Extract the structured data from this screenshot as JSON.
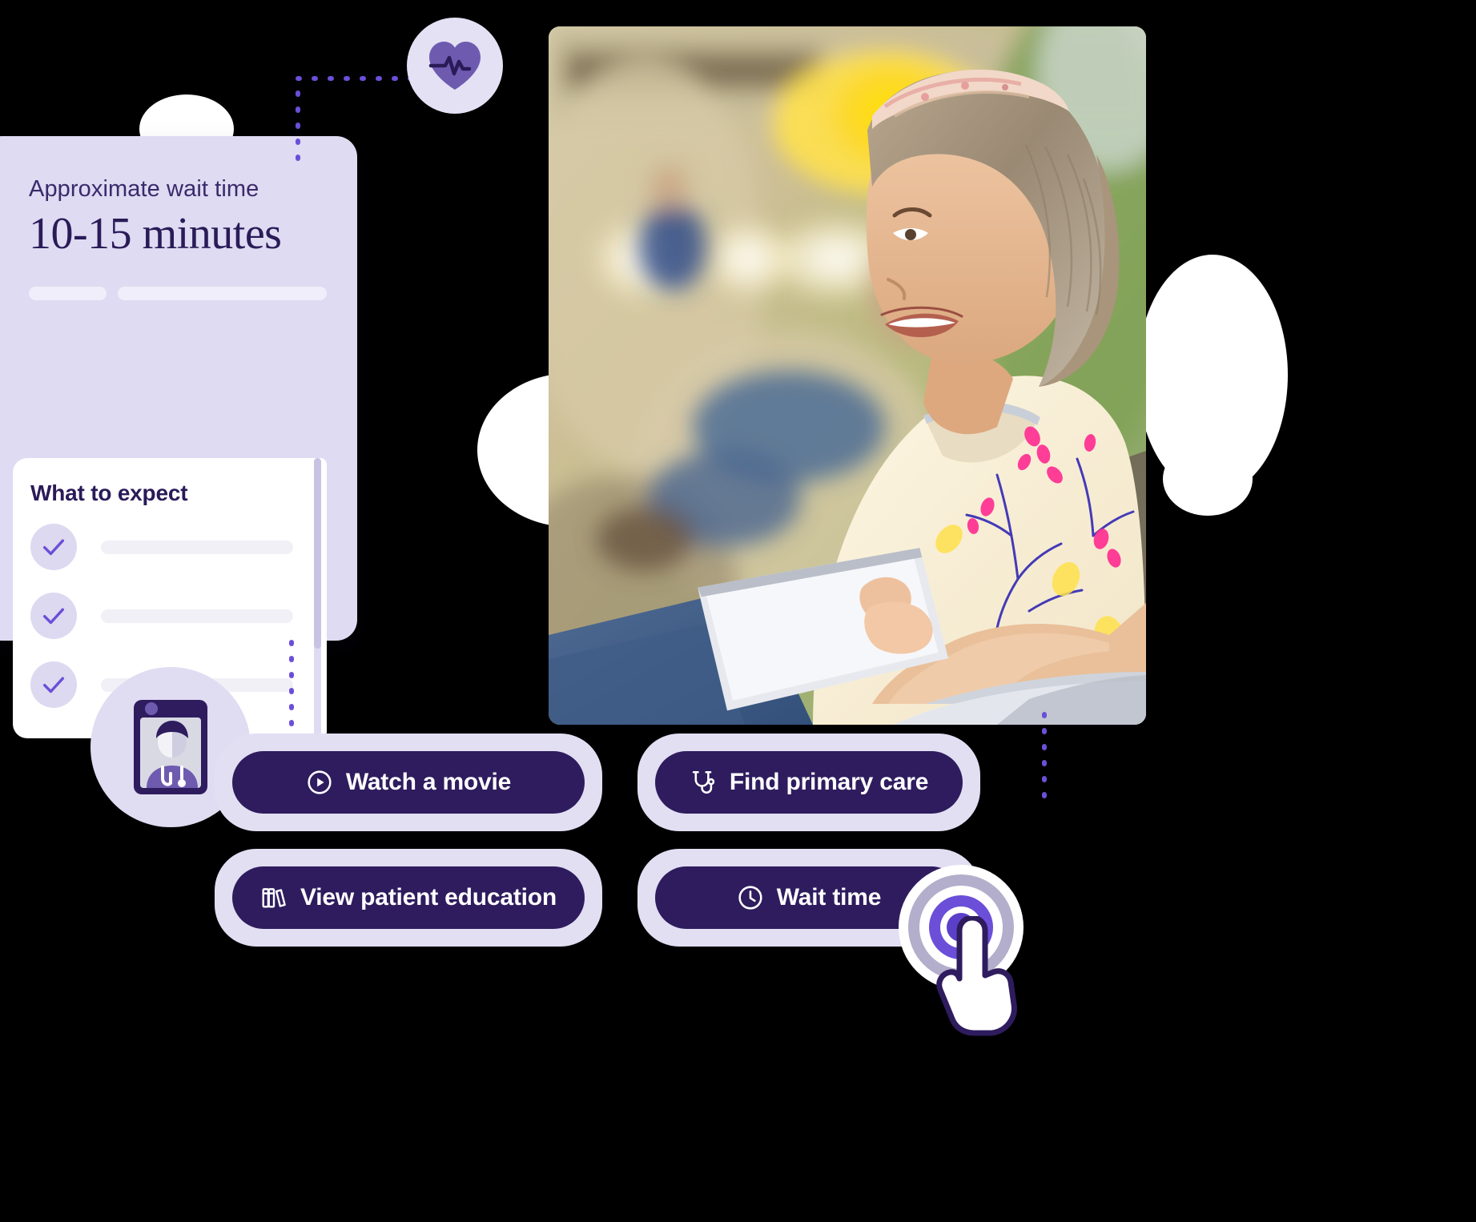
{
  "card": {
    "wait_label": "Approximate wait time",
    "wait_value": "10-15 minutes",
    "expect_title": "What to expect",
    "checklist": [
      {
        "icon": "check-icon",
        "text": ""
      },
      {
        "icon": "check-icon",
        "text": ""
      },
      {
        "icon": "check-icon",
        "text": ""
      }
    ]
  },
  "badges": {
    "heart": "heart-pulse-icon",
    "telehealth": "telehealth-video-icon"
  },
  "photo": {
    "alt": "Smiling woman with headband sitting in a waiting room using a tablet"
  },
  "actions": {
    "buttons": [
      {
        "label": "Watch a movie",
        "icon": "play-circle-icon"
      },
      {
        "label": "Find primary care",
        "icon": "stethoscope-icon"
      },
      {
        "label": "View patient education",
        "icon": "books-icon"
      },
      {
        "label": "Wait time",
        "icon": "clock-icon"
      }
    ]
  },
  "cursor": {
    "icon": "pointing-hand-cursor",
    "target": "Wait time"
  },
  "colors": {
    "card_bg": "#dedbf2",
    "button_bg": "#2e1c5e",
    "button_wrap_bg": "#e2dff3",
    "accent_purple": "#6b4fd8",
    "text_dark": "#2a1b58",
    "badge_bg": "#e0dcf2",
    "check_circle_bg": "#ddd9f0",
    "placeholder_bar": "#f0eefa",
    "page_bg": "#000000"
  }
}
